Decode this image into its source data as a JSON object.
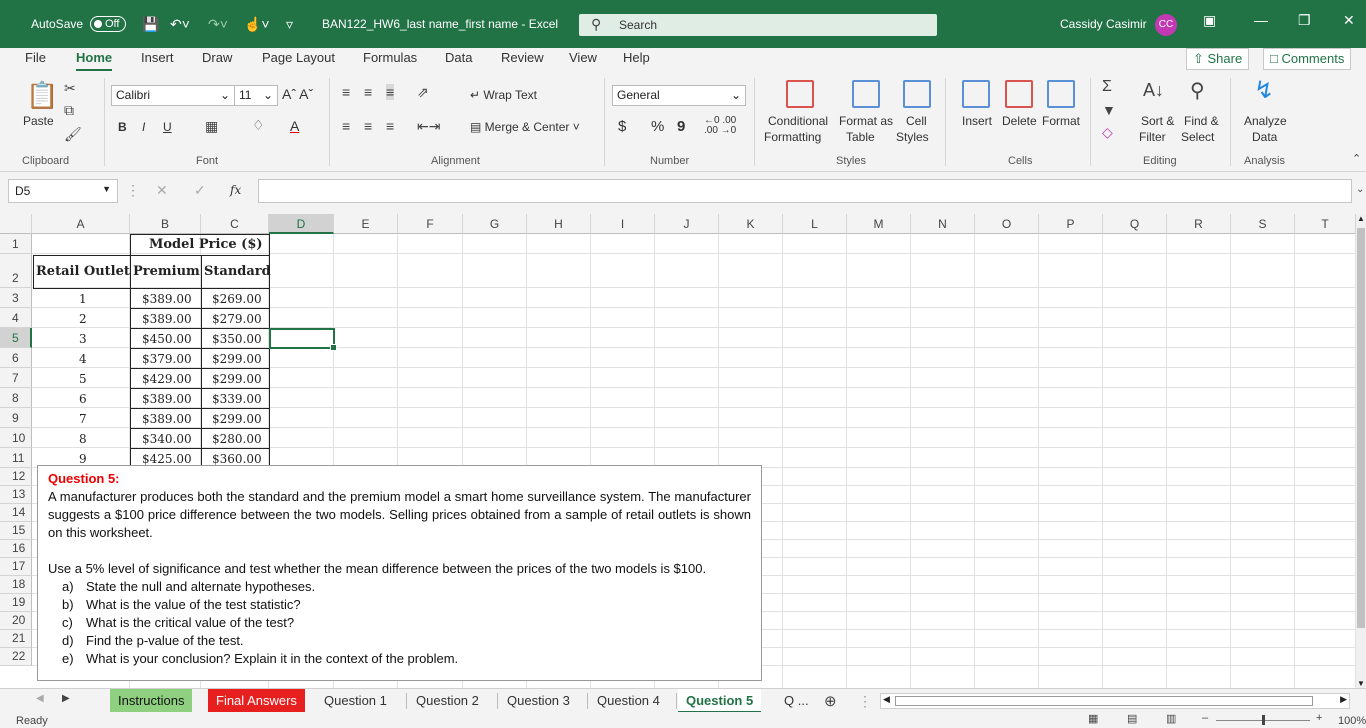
{
  "titlebar": {
    "autosave_label": "AutoSave",
    "autosave_state": "Off",
    "doc_title": "BAN122_HW6_last name_first name  -  Excel",
    "search_placeholder": "Search",
    "user_name": "Cassidy Casimir",
    "user_initials": "CC"
  },
  "menu": {
    "items": [
      "File",
      "Home",
      "Insert",
      "Draw",
      "Page Layout",
      "Formulas",
      "Data",
      "Review",
      "View",
      "Help"
    ],
    "active": "Home",
    "share_label": "Share",
    "comments_label": "Comments"
  },
  "ribbon": {
    "clipboard": {
      "paste": "Paste",
      "group": "Clipboard"
    },
    "font": {
      "name": "Calibri",
      "size": "11",
      "bold": "B",
      "italic": "I",
      "underline": "U",
      "group": "Font"
    },
    "alignment": {
      "wrap": "Wrap Text",
      "merge": "Merge & Center",
      "group": "Alignment"
    },
    "number": {
      "format": "General",
      "currency": "$",
      "percent": "%",
      "comma": "9",
      "group": "Number"
    },
    "styles": {
      "conditional_1": "Conditional",
      "conditional_2": "Formatting",
      "format_as_1": "Format as",
      "format_as_2": "Table",
      "cell_1": "Cell",
      "cell_2": "Styles",
      "group": "Styles"
    },
    "cells": {
      "insert": "Insert",
      "delete": "Delete",
      "format": "Format",
      "group": "Cells"
    },
    "editing": {
      "sort_1": "Sort &",
      "sort_2": "Filter",
      "find_1": "Find &",
      "find_2": "Select",
      "group": "Editing"
    },
    "analysis": {
      "analyze_1": "Analyze",
      "analyze_2": "Data",
      "group": "Analysis"
    }
  },
  "formula_bar": {
    "name_box": "D5",
    "fx": "fx",
    "content": ""
  },
  "columns": [
    "A",
    "B",
    "C",
    "D",
    "E",
    "F",
    "G",
    "H",
    "I",
    "J",
    "K",
    "L",
    "M",
    "N",
    "O",
    "P",
    "Q",
    "R",
    "S",
    "T"
  ],
  "selected_column": "D",
  "rows": [
    "1",
    "2",
    "3",
    "4",
    "5",
    "6",
    "7",
    "8",
    "9",
    "10",
    "11",
    "12",
    "13",
    "14",
    "15",
    "16",
    "17",
    "18",
    "19",
    "20",
    "21",
    "22"
  ],
  "selected_row": "5",
  "table": {
    "header_group": "Model Price ($)",
    "col_outlet": "Retail Outlet",
    "col_premium": "Premium",
    "col_standard": "Standard",
    "rows": [
      {
        "outlet": "1",
        "premium": "$389.00",
        "standard": "$269.00"
      },
      {
        "outlet": "2",
        "premium": "$389.00",
        "standard": "$279.00"
      },
      {
        "outlet": "3",
        "premium": "$450.00",
        "standard": "$350.00"
      },
      {
        "outlet": "4",
        "premium": "$379.00",
        "standard": "$299.00"
      },
      {
        "outlet": "5",
        "premium": "$429.00",
        "standard": "$299.00"
      },
      {
        "outlet": "6",
        "premium": "$389.00",
        "standard": "$339.00"
      },
      {
        "outlet": "7",
        "premium": "$389.00",
        "standard": "$299.00"
      },
      {
        "outlet": "8",
        "premium": "$340.00",
        "standard": "$280.00"
      },
      {
        "outlet": "9",
        "premium": "$425.00",
        "standard": "$360.00"
      }
    ]
  },
  "question": {
    "title": "Question 5:",
    "paragraph": "A manufacturer produces both the standard and the premium model a smart home surveillance system. The manufacturer suggests a $100 price difference between the two models. Selling prices obtained from a sample of retail outlets is shown on this worksheet.",
    "instruction": "Use a 5% level of significance and test whether the mean difference between the prices of the two models is $100.",
    "items": [
      {
        "key": "a)",
        "text": "State the null and alternate hypotheses."
      },
      {
        "key": "b)",
        "text": "What is the value of the test statistic?"
      },
      {
        "key": "c)",
        "text": "What is the critical value of the test?"
      },
      {
        "key": "d)",
        "text": "Find the p-value of the test."
      },
      {
        "key": "e)",
        "text": "What is your conclusion? Explain it in the context of the problem."
      }
    ]
  },
  "sheets": {
    "tabs": [
      "Instructions",
      "Final Answers",
      "Question 1",
      "Question 2",
      "Question 3",
      "Question 4",
      "Question 5"
    ],
    "active": "Question 5",
    "more": "Q ..."
  },
  "status": {
    "ready": "Ready",
    "zoom": "100%"
  },
  "colors": {
    "excel_green": "#217346",
    "red_tab": "#e81f1f",
    "green_tab": "#8ed07f",
    "question_red": "#e00000"
  }
}
